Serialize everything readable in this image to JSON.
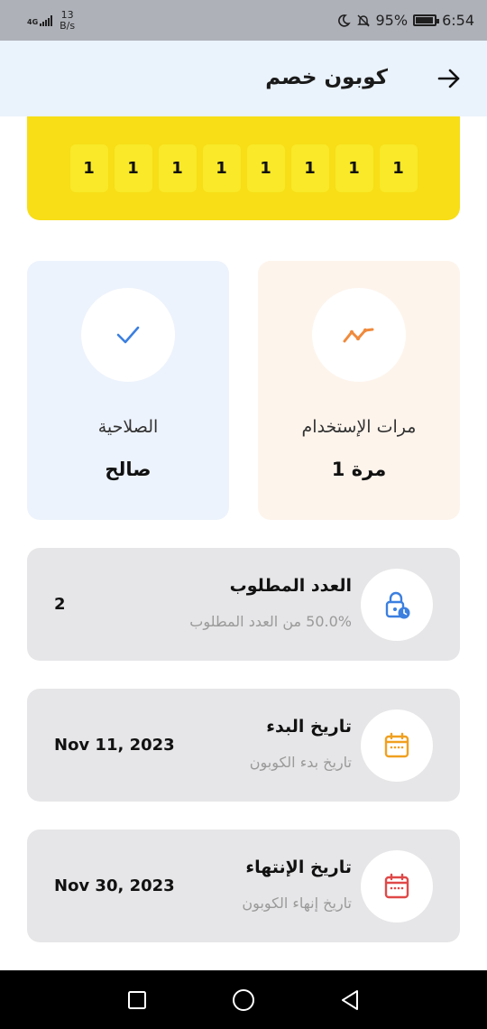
{
  "status_bar": {
    "network": "4G",
    "speed": "13",
    "speed_unit": "B/s",
    "battery": "95%",
    "time": "6:54"
  },
  "header": {
    "title": "كوبون خصم",
    "back_icon": "arrow-right-icon"
  },
  "coupon": {
    "digits": [
      "1",
      "1",
      "1",
      "1",
      "1",
      "1",
      "1",
      "1"
    ],
    "banner_color": "#f7de17"
  },
  "cards": {
    "usage": {
      "label": "مرات الإستخدام",
      "value": "1 مرة",
      "icon": "trend-icon",
      "color": "#f08a3c"
    },
    "validity": {
      "label": "الصلاحية",
      "value": "صالح",
      "icon": "check-icon",
      "color": "#3b7fe0"
    }
  },
  "rows": [
    {
      "title": "العدد المطلوب",
      "subtitle": "50.0% من العدد المطلوب",
      "value": "2",
      "icon": "lock-clock-icon",
      "color": "#3b7fe0"
    },
    {
      "title": "تاريخ البدء",
      "subtitle": "تاريخ بدء الكوبون",
      "value": "Nov 11, 2023",
      "icon": "calendar-icon",
      "color": "#f0a020"
    },
    {
      "title": "تاريخ الإنتهاء",
      "subtitle": "تاريخ إنهاء الكوبون",
      "value": "Nov 30, 2023",
      "icon": "calendar-icon",
      "color": "#e04848"
    }
  ],
  "nav": {
    "recent_icon": "square-icon",
    "home_icon": "circle-icon",
    "back_icon": "triangle-back-icon"
  }
}
